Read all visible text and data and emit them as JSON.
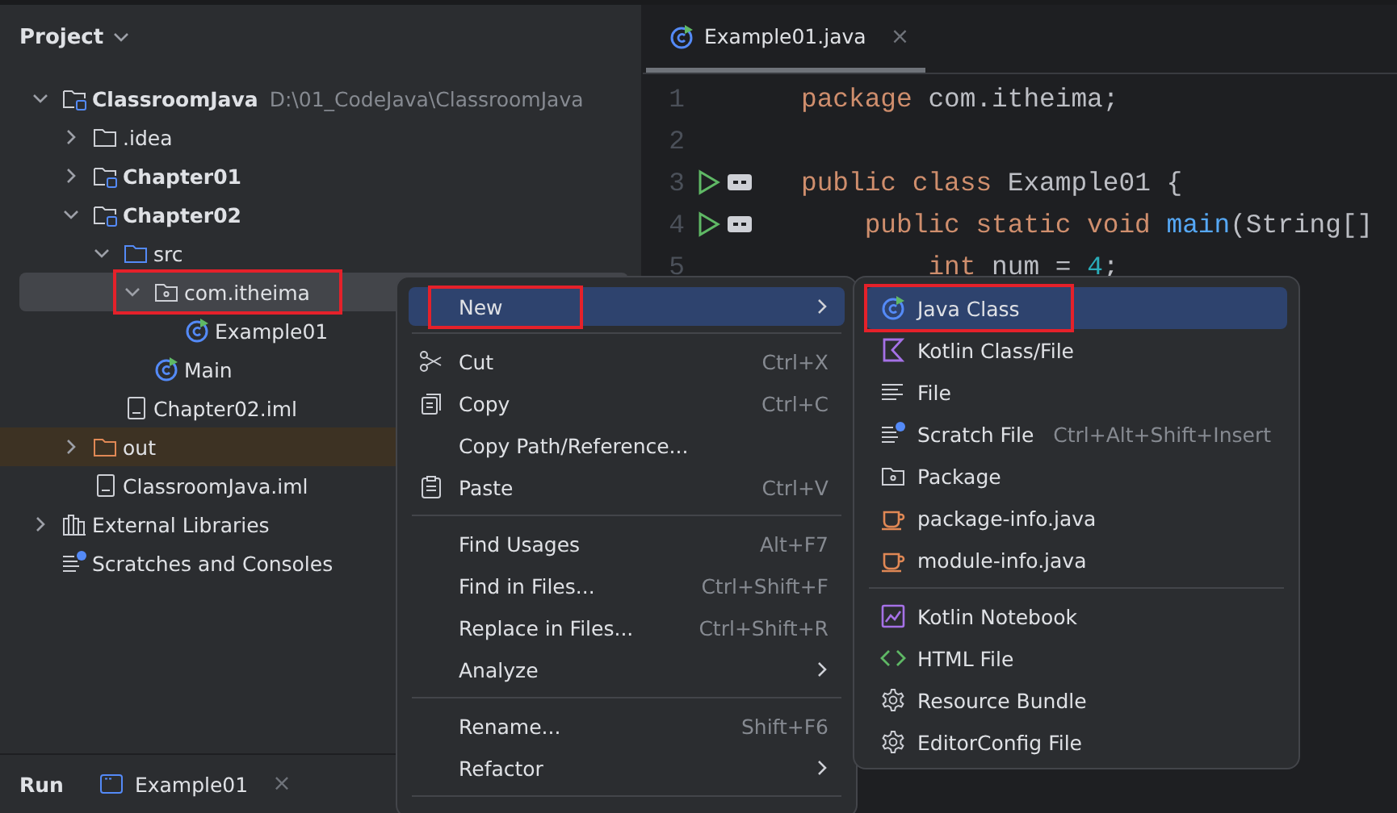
{
  "project_panel": {
    "title": "Project",
    "tree": [
      {
        "label": "ClassroomJava",
        "kind": "module",
        "path": "D:\\01_CodeJava\\ClassroomJava",
        "expanded": true,
        "selected": false,
        "highlighted": false,
        "children": [
          {
            "label": ".idea",
            "kind": "folder",
            "expanded": false,
            "selected": false,
            "highlighted": false
          },
          {
            "label": "Chapter01",
            "kind": "module",
            "expanded": false,
            "selected": false,
            "highlighted": false
          },
          {
            "label": "Chapter02",
            "kind": "module",
            "expanded": true,
            "selected": false,
            "highlighted": false,
            "children": [
              {
                "label": "src",
                "kind": "source-folder",
                "expanded": true,
                "selected": false,
                "highlighted": false,
                "children": [
                  {
                    "label": "com.itheima",
                    "kind": "package",
                    "expanded": true,
                    "selected": true,
                    "highlighted": true,
                    "children": [
                      {
                        "label": "Example01",
                        "kind": "class",
                        "selected": false,
                        "highlighted": false
                      }
                    ]
                  },
                  {
                    "label": "Main",
                    "kind": "class",
                    "selected": false,
                    "highlighted": false
                  }
                ]
              },
              {
                "label": "Chapter02.iml",
                "kind": "iml",
                "selected": false,
                "highlighted": false
              }
            ]
          },
          {
            "label": "out",
            "kind": "excluded-folder",
            "expanded": false,
            "selected": false,
            "highlighted": false
          },
          {
            "label": "ClassroomJava.iml",
            "kind": "iml",
            "selected": false,
            "highlighted": false
          }
        ]
      },
      {
        "label": "External Libraries",
        "kind": "libraries",
        "expanded": false,
        "selected": false,
        "highlighted": false
      },
      {
        "label": "Scratches and Consoles",
        "kind": "scratches",
        "selected": false,
        "highlighted": false
      }
    ]
  },
  "run_bar": {
    "title": "Run",
    "tab": "Example01",
    "close": "×"
  },
  "editor": {
    "tab": {
      "label": "Example01.java",
      "close": "×"
    },
    "lines": [
      {
        "number": "1",
        "run_gutter": false,
        "tokens": [
          {
            "kind": "keyword",
            "text": "package"
          },
          {
            "kind": "plain",
            "text": " com.itheima;"
          }
        ]
      },
      {
        "number": "2",
        "run_gutter": false
      },
      {
        "number": "3",
        "run_gutter": true,
        "tokens": [
          {
            "kind": "keyword",
            "text": "public class"
          },
          {
            "kind": "plain",
            "text": " Example01 {"
          }
        ]
      },
      {
        "number": "4",
        "run_gutter": true,
        "tokens": [
          {
            "kind": "keyword",
            "text": "    public static void"
          },
          {
            "kind": "function",
            "text": " main"
          },
          {
            "kind": "plain",
            "text": "(String[]"
          }
        ]
      },
      {
        "number": "5",
        "run_gutter": false,
        "tokens": [
          {
            "kind": "keyword",
            "text": "        int"
          },
          {
            "kind": "plain",
            "text": " num = "
          },
          {
            "kind": "number",
            "text": "4"
          },
          {
            "kind": "plain",
            "text": ";"
          }
        ]
      }
    ]
  },
  "context_menu": {
    "items": [
      {
        "kind": "item",
        "label": "New",
        "submenu": true,
        "selected": true,
        "highlighted": true
      },
      {
        "kind": "separator"
      },
      {
        "kind": "item",
        "label": "Cut",
        "shortcut": "Ctrl+X",
        "selected": false,
        "highlighted": false
      },
      {
        "kind": "item",
        "label": "Copy",
        "shortcut": "Ctrl+C",
        "selected": false,
        "highlighted": false
      },
      {
        "kind": "item",
        "label": "Copy Path/Reference...",
        "selected": false,
        "highlighted": false
      },
      {
        "kind": "item",
        "label": "Paste",
        "shortcut": "Ctrl+V",
        "selected": false,
        "highlighted": false
      },
      {
        "kind": "separator"
      },
      {
        "kind": "item",
        "label": "Find Usages",
        "shortcut": "Alt+F7",
        "selected": false,
        "highlighted": false
      },
      {
        "kind": "item",
        "label": "Find in Files...",
        "shortcut": "Ctrl+Shift+F",
        "selected": false,
        "highlighted": false
      },
      {
        "kind": "item",
        "label": "Replace in Files...",
        "shortcut": "Ctrl+Shift+R",
        "selected": false,
        "highlighted": false
      },
      {
        "kind": "item",
        "label": "Analyze",
        "submenu": true,
        "selected": false,
        "highlighted": false
      },
      {
        "kind": "separator"
      },
      {
        "kind": "item",
        "label": "Rename...",
        "shortcut": "Shift+F6",
        "selected": false,
        "highlighted": false
      },
      {
        "kind": "item",
        "label": "Refactor",
        "submenu": true,
        "selected": false,
        "highlighted": false
      },
      {
        "kind": "separator"
      }
    ]
  },
  "new_submenu": {
    "items": [
      {
        "kind": "item",
        "label": "Java Class",
        "selected": true,
        "highlighted": true
      },
      {
        "kind": "item",
        "label": "Kotlin Class/File",
        "selected": false,
        "highlighted": false
      },
      {
        "kind": "item",
        "label": "File",
        "selected": false,
        "highlighted": false
      },
      {
        "kind": "item",
        "label": "Scratch File",
        "shortcut": "Ctrl+Alt+Shift+Insert",
        "selected": false,
        "highlighted": false
      },
      {
        "kind": "item",
        "label": "Package",
        "selected": false,
        "highlighted": false
      },
      {
        "kind": "item",
        "label": "package-info.java",
        "selected": false,
        "highlighted": false
      },
      {
        "kind": "item",
        "label": "module-info.java",
        "selected": false,
        "highlighted": false
      },
      {
        "kind": "separator"
      },
      {
        "kind": "item",
        "label": "Kotlin Notebook",
        "selected": false,
        "highlighted": false
      },
      {
        "kind": "item",
        "label": "HTML File",
        "selected": false,
        "highlighted": false
      },
      {
        "kind": "item",
        "label": "Resource Bundle",
        "selected": false,
        "highlighted": false
      },
      {
        "kind": "item",
        "label": "EditorConfig File",
        "selected": false,
        "highlighted": false
      }
    ]
  }
}
